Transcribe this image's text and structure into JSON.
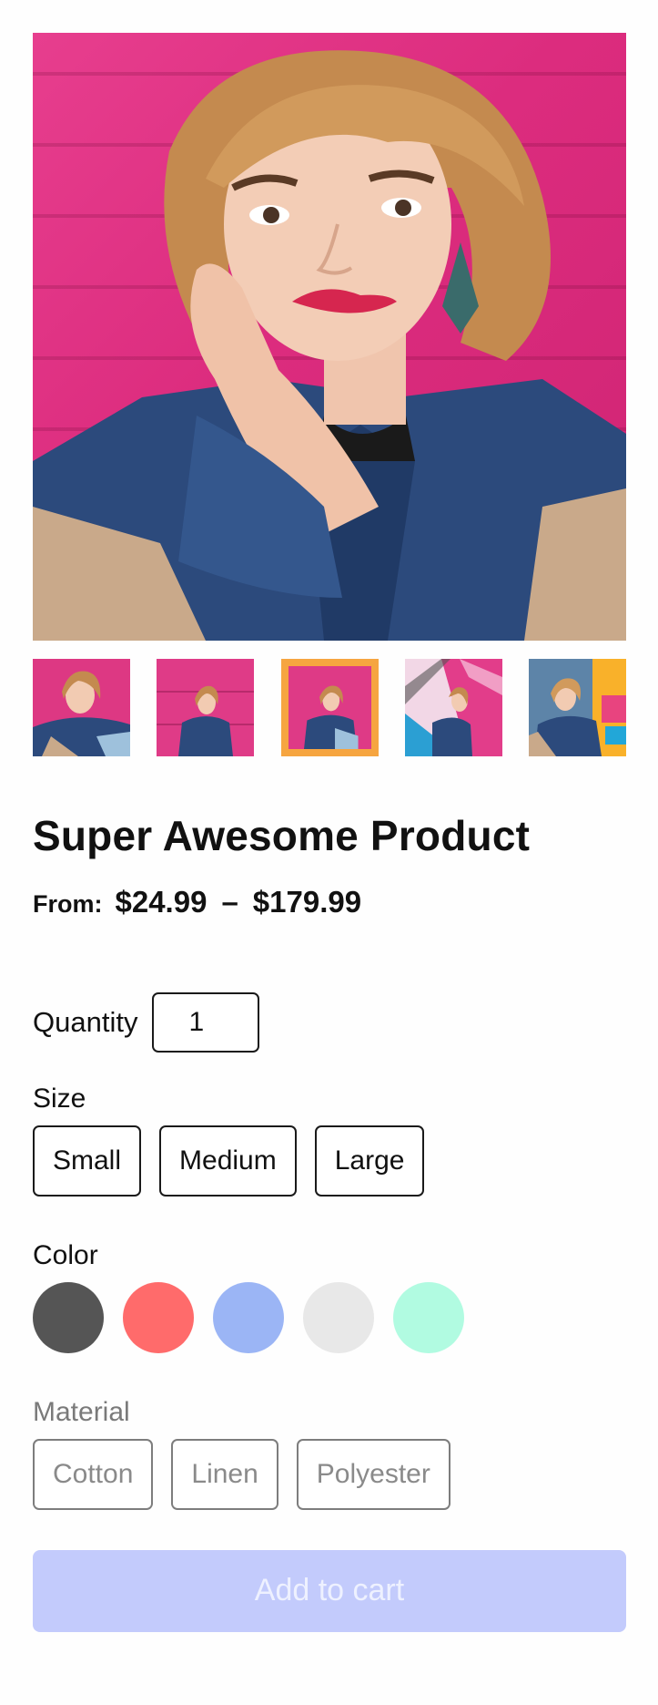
{
  "gallery": {
    "main_image": "product-photo-woman-pink-wall",
    "thumbnails": [
      {
        "image": "thumb-closeup"
      },
      {
        "image": "thumb-seated-pink-wall"
      },
      {
        "image": "thumb-selected-pink-wall",
        "selected": true
      },
      {
        "image": "thumb-stairs-colorful-wall"
      },
      {
        "image": "thumb-yellow-wall"
      }
    ],
    "selected_border_color": "#f6a540"
  },
  "product": {
    "title": "Super Awesome Product",
    "price_prefix": "From:",
    "price_min": "$24.99",
    "price_separator": "–",
    "price_max": "$179.99"
  },
  "quantity": {
    "label": "Quantity",
    "value": "1"
  },
  "size": {
    "label": "Size",
    "options": [
      "Small",
      "Medium",
      "Large"
    ]
  },
  "color": {
    "label": "Color",
    "swatches": [
      "#555555",
      "#ff6b6b",
      "#9bb5f5",
      "#e8e8e8",
      "#b1fbe1"
    ]
  },
  "material": {
    "label": "Material",
    "options": [
      "Cotton",
      "Linen",
      "Polyester"
    ]
  },
  "cart": {
    "label": "Add to cart",
    "background": "#c3cbfc"
  }
}
